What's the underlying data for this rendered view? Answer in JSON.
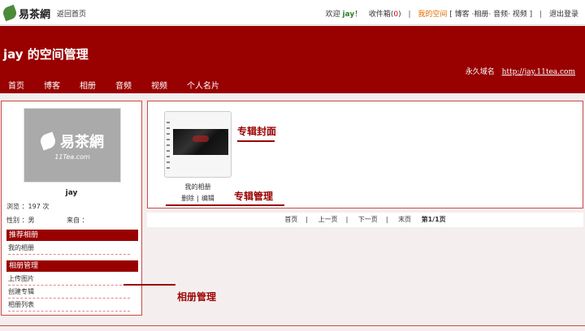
{
  "topbar": {
    "logo_text": "易茶網",
    "home_link": "返回首页",
    "welcome": "欢迎",
    "username": "jay",
    "exclaim": "！",
    "inbox_label": "收件箱(",
    "inbox_count": "0",
    "inbox_close": ")",
    "sep": "|",
    "myspace": "我的空间",
    "space_links": "[  博客  ·相册·  音频·  视频  ]",
    "logout": "退出登录"
  },
  "banner": {
    "title": "jay 的空间管理",
    "domain_label": "永久域名",
    "domain_url": "http://jay.11tea.com",
    "nav": [
      "首页",
      "博客",
      "相册",
      "音频",
      "视频",
      "个人名片"
    ]
  },
  "sidebar": {
    "avatar_logo": "易茶網",
    "avatar_sub": "11Tea.com",
    "name": "jay",
    "views": "浏览 ：197 次",
    "gender": "性别 ：男",
    "from": "来自 ：",
    "recommend_head": "推荐相册",
    "recommend_items": [
      "我的相册"
    ],
    "manage_head": "相册管理",
    "manage_items": [
      "上传图片",
      "创建专辑",
      "相册列表"
    ]
  },
  "main": {
    "album_name": "我的相册",
    "delete": "删除",
    "bar": "|",
    "edit": "编辑"
  },
  "pager": {
    "first": "首页",
    "prev": "上一页",
    "next": "下一页",
    "last": "末页",
    "page_info": "第1/1页",
    "sep": "|"
  },
  "annotations": {
    "cover": "专辑封面",
    "manage_album": "专辑管理",
    "album_manage": "相册管理"
  },
  "colors": {
    "brand_red": "#990000",
    "accent_orange": "#e06a00",
    "user_green": "#2d7d2d"
  }
}
